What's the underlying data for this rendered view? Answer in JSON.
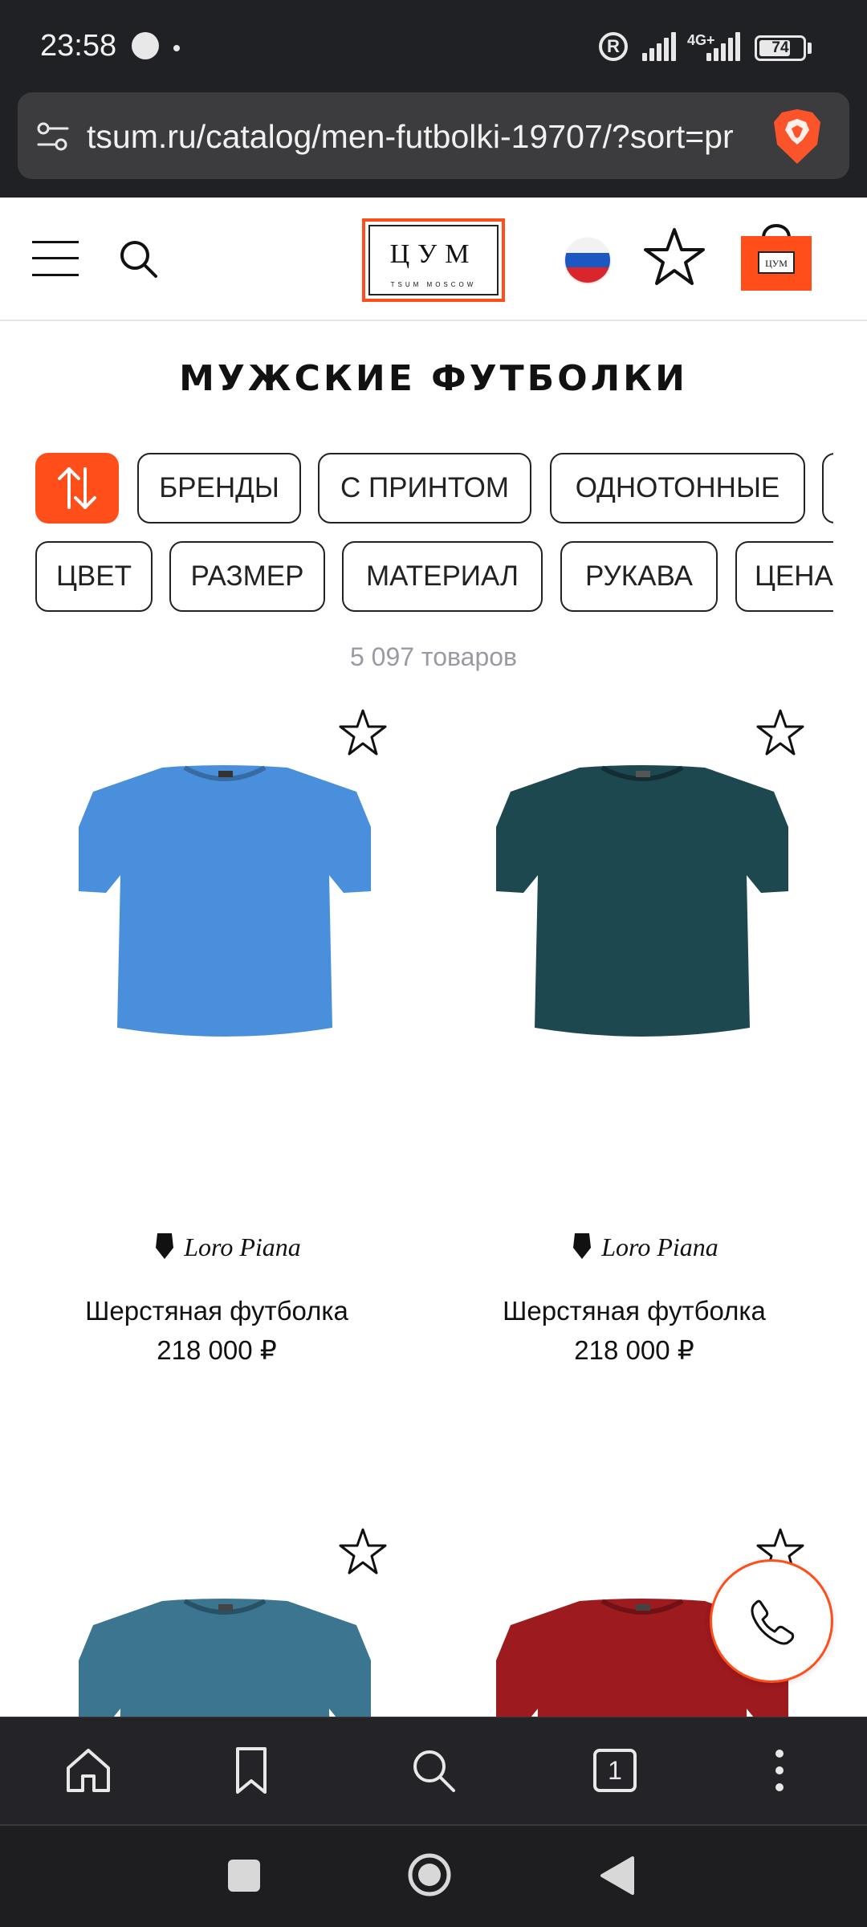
{
  "status_bar": {
    "time": "23:58",
    "network": "4G+",
    "battery_percent": "74",
    "battery_level": 0.74
  },
  "browser": {
    "url": "tsum.ru/catalog/men-futbolki-19707/?sort=pr",
    "tabs_count": "1"
  },
  "header": {
    "logo_letters": "ЦУМ",
    "logo_sub": "TSUM MOSCOW"
  },
  "page": {
    "title": "МУЖСКИЕ ФУТБОЛКИ",
    "products_count": "5 097 товаров"
  },
  "filters": {
    "row1": [
      "БРЕНДЫ",
      "С ПРИНТОМ",
      "ОДНОТОННЫЕ"
    ],
    "row2": [
      "ЦВЕТ",
      "РАЗМЕР",
      "МАТЕРИАЛ",
      "РУКАВА",
      "ЦЕНА"
    ]
  },
  "products": [
    {
      "brand": "Loro Piana",
      "name": "Шерстяная футболка",
      "price": "218 000 ₽",
      "color": "#4a8fdb"
    },
    {
      "brand": "Loro Piana",
      "name": "Шерстяная футболка",
      "price": "218 000 ₽",
      "color": "#1d4850"
    },
    {
      "brand": "",
      "name": "",
      "price": "",
      "color": "#3b7590"
    },
    {
      "brand": "",
      "name": "",
      "price": "",
      "color": "#9d1a1f"
    }
  ],
  "colors": {
    "accent": "#ff4e1a",
    "browser_chrome": "#202124",
    "muted_text": "#9a9aa2"
  },
  "icons": {
    "menu": "hamburger-icon",
    "search": "search-icon",
    "favorite": "star-icon",
    "cart": "shopping-bag-icon",
    "sort": "sort-arrows-icon",
    "phone": "phone-icon"
  }
}
